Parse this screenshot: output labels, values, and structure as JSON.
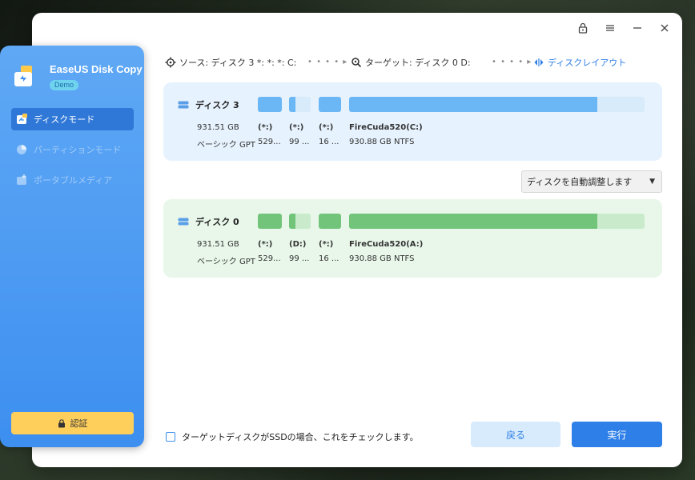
{
  "app": {
    "name": "EaseUS Disk Copy",
    "badge": "Demo"
  },
  "sidebar": {
    "items": [
      {
        "label": "ディスクモード",
        "icon": "disk-mode-icon"
      },
      {
        "label": "パーティションモード",
        "icon": "partition-mode-icon"
      },
      {
        "label": "ポータブルメディア",
        "icon": "portable-media-icon"
      }
    ],
    "auth_label": "認証"
  },
  "path": {
    "source": "ソース: ディスク 3 *: *: *: C:",
    "target": "ターゲット: ディスク 0 D:",
    "layout": "ディスクレイアウト"
  },
  "source_disk": {
    "name": "ディスク 3",
    "size": "931.51 GB",
    "type": "ベーシック GPT",
    "partitions": [
      {
        "label": "(*:)",
        "detail": "529..."
      },
      {
        "label": "(*:)",
        "detail": "99 ..."
      },
      {
        "label": "(*:)",
        "detail": "16 ..."
      },
      {
        "label": "FireCuda520(C:)",
        "detail": "930.88 GB NTFS"
      }
    ],
    "colors": {
      "used": "#6bb6f5",
      "free": "#d8ebfb"
    }
  },
  "target_disk": {
    "name": "ディスク 0",
    "size": "931.51 GB",
    "type": "ベーシック GPT",
    "partitions": [
      {
        "label": "(*:)",
        "detail": "529..."
      },
      {
        "label": "(D:)",
        "detail": "99 ..."
      },
      {
        "label": "(*:)",
        "detail": "16 ..."
      },
      {
        "label": "FireCuda520(A:)",
        "detail": "930.88 GB NTFS"
      }
    ],
    "colors": {
      "used": "#72c47a",
      "free": "#c9ebcb"
    }
  },
  "resize_dropdown": {
    "value": "ディスクを自動調整します"
  },
  "footer": {
    "ssd_check_label": "ターゲットディスクがSSDの場合、これをチェックします。",
    "back_label": "戻る",
    "execute_label": "実行"
  }
}
